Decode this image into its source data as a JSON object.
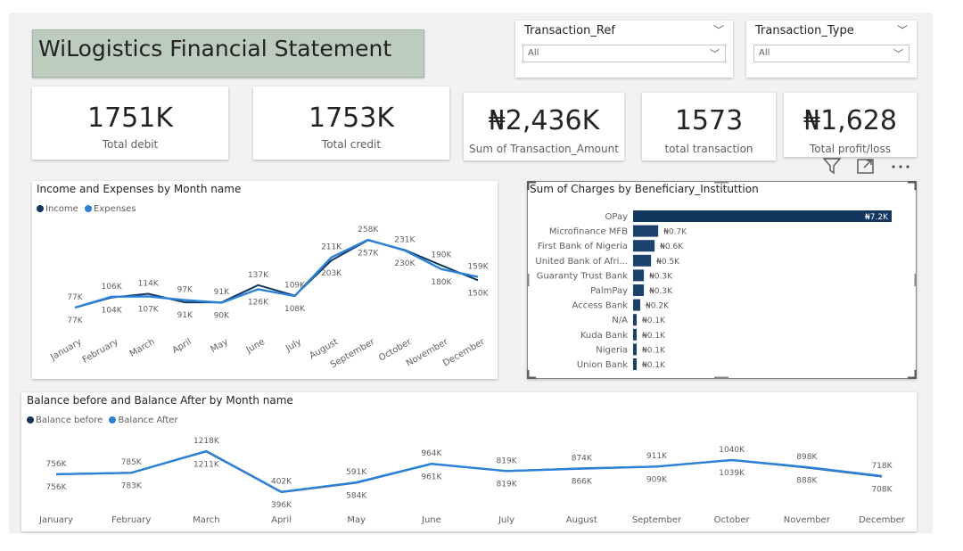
{
  "title": "WiLogistics Financial Statement",
  "slicers": [
    {
      "label": "Transaction_Ref",
      "value": "All"
    },
    {
      "label": "Transaction_Type",
      "value": "All"
    }
  ],
  "kpis": [
    {
      "value": "1751K",
      "label": "Total debit"
    },
    {
      "value": "1753K",
      "label": "Total credit"
    },
    {
      "value": "₦2,436K",
      "label": "Sum of Transaction_Amount"
    },
    {
      "value": "1573",
      "label": "total transaction"
    },
    {
      "value": "₦1,628",
      "label": "Total profit/loss"
    }
  ],
  "colors": {
    "dark_navy": "#12375f",
    "bright_blue": "#2b82d9",
    "bar": "#12375f"
  },
  "toolbar": {
    "filter_icon": "filter-icon",
    "focus_icon": "focus-mode-icon",
    "more_icon": "more-options-icon"
  },
  "chart_data": [
    {
      "type": "line",
      "title": "Income and Expenses by Month name",
      "categories": [
        "January",
        "February",
        "March",
        "April",
        "May",
        "June",
        "July",
        "August",
        "September",
        "October",
        "November",
        "December"
      ],
      "series": [
        {
          "name": "Income",
          "color": "#12375f",
          "values": [
            77,
            104,
            114,
            91,
            91,
            137,
            109,
            203,
            257,
            231,
            190,
            150
          ],
          "labels": [
            "77K",
            "104K",
            "114K",
            "91K",
            "91K",
            "137K",
            "109K",
            "203K",
            "257K",
            "231K",
            "190K",
            "150K"
          ]
        },
        {
          "name": "Expenses",
          "color": "#2b82d9",
          "values": [
            77,
            106,
            107,
            97,
            90,
            126,
            108,
            211,
            258,
            230,
            180,
            159
          ],
          "labels": [
            "77K",
            "106K",
            "107K",
            "97K",
            "90K",
            "126K",
            "108K",
            "211K",
            "258K",
            "230K",
            "180K",
            "159K"
          ]
        }
      ],
      "legend": "top-left"
    },
    {
      "type": "bar",
      "orientation": "horizontal",
      "title": "Sum of Charges by Beneficiary_Instituttion",
      "categories": [
        "OPay",
        "Microfinance MFB",
        "First Bank of Nigeria",
        "United Bank of Afri...",
        "Guaranty Trust Bank",
        "PalmPay",
        "Access Bank",
        "N/A",
        "Kuda Bank",
        "Nigeria",
        "Union Bank"
      ],
      "values": [
        7.2,
        0.7,
        0.6,
        0.5,
        0.3,
        0.3,
        0.2,
        0.1,
        0.1,
        0.1,
        0.1
      ],
      "labels": [
        "₦7.2K",
        "₦0.7K",
        "₦0.6K",
        "₦0.5K",
        "₦0.3K",
        "₦0.3K",
        "₦0.2K",
        "₦0.1K",
        "₦0.1K",
        "₦0.1K",
        "₦0.1K"
      ]
    },
    {
      "type": "line",
      "title": "Balance before and Balance After by Month name",
      "categories": [
        "January",
        "February",
        "March",
        "April",
        "May",
        "June",
        "July",
        "August",
        "September",
        "October",
        "November",
        "December"
      ],
      "series": [
        {
          "name": "Balance before",
          "color": "#12375f",
          "values": [
            756,
            785,
            1211,
            396,
            584,
            961,
            819,
            874,
            911,
            1039,
            888,
            708
          ],
          "labels": [
            "756K",
            "785K",
            "1211K",
            "396K",
            "584K",
            "961K",
            "819K",
            "874K",
            "911K",
            "1039K",
            "888K",
            "708K"
          ]
        },
        {
          "name": "Balance After",
          "color": "#2b82d9",
          "values": [
            756,
            783,
            1218,
            402,
            591,
            964,
            819,
            866,
            909,
            1040,
            898,
            718
          ],
          "labels": [
            "756K",
            "783K",
            "1218K",
            "402K",
            "591K",
            "964K",
            "819K",
            "866K",
            "909K",
            "1040K",
            "898K",
            "718K"
          ]
        }
      ],
      "legend": "top-left"
    }
  ]
}
